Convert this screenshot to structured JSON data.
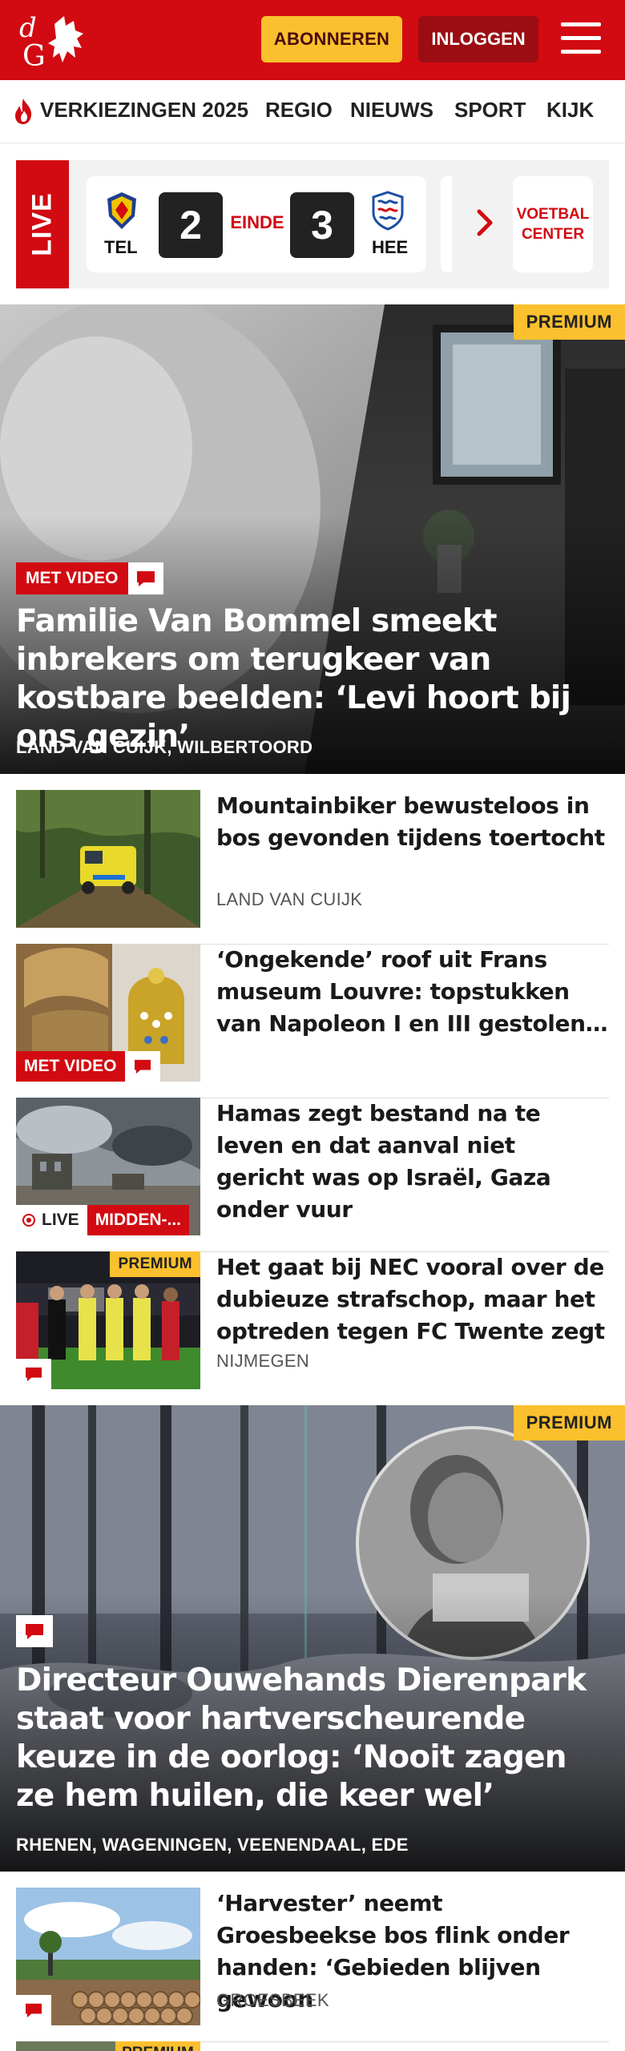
{
  "header": {
    "subscribe_label": "ABONNEREN",
    "login_label": "INLOGGEN",
    "brand_color": "#d20a11",
    "accent_color": "#fbc02d"
  },
  "nav": {
    "items": [
      "VERKIEZINGEN 2025",
      "REGIO",
      "NIEUWS",
      "SPORT",
      "KIJK"
    ]
  },
  "live_scores": {
    "live_label": "LIVE",
    "match": {
      "home_team": "TEL",
      "home_score": "2",
      "status": "EINDE",
      "away_score": "3",
      "away_team": "HEE"
    },
    "voetbal_center_label": "VOETBAL CENTER"
  },
  "hero1": {
    "premium_label": "PREMIUM",
    "video_label": "MET VIDEO",
    "title": "Familie Van Bommel smeekt inbrekers om terugkeer van kostbare beelden: ‘Levi hoort bij ons gezin’",
    "location": "LAND VAN CUIJK, WILBERTOORD"
  },
  "articles": [
    {
      "title": "Mountainbiker bewusteloos in bos gevonden tijdens toertocht",
      "location": "LAND VAN CUIJK"
    },
    {
      "title": "‘Ongekende’ roof uit Frans museum Louvre: topstukken van Napoleon I en III gestolen, kroon",
      "video_label": "MET VIDEO"
    },
    {
      "title": "Hamas zegt bestand na te leven en dat aanval niet gericht was op Israël, Gaza onder vuur",
      "live_label": "LIVE",
      "category_label": "MIDDEN-..."
    },
    {
      "title": "Het gaat bij NEC vooral over de dubieuze strafschop, maar het optreden tegen FC Twente zegt",
      "location": "NIJMEGEN",
      "premium_label": "PREMIUM"
    }
  ],
  "hero2": {
    "premium_label": "PREMIUM",
    "title": "Directeur Ouwehands Dierenpark staat voor hartverscheurende keuze in de oorlog: ‘Nooit zagen ze hem huilen, die keer wel’",
    "location": "RHENEN, WAGENINGEN, VEENENDAAL, EDE"
  },
  "articles2": [
    {
      "title": "‘Harvester’ neemt Groesbeekse bos flink onder handen: ‘Gebieden blijven gewoon",
      "location": "GROESBEEK"
    },
    {
      "premium_label": "PREMIUM"
    }
  ]
}
